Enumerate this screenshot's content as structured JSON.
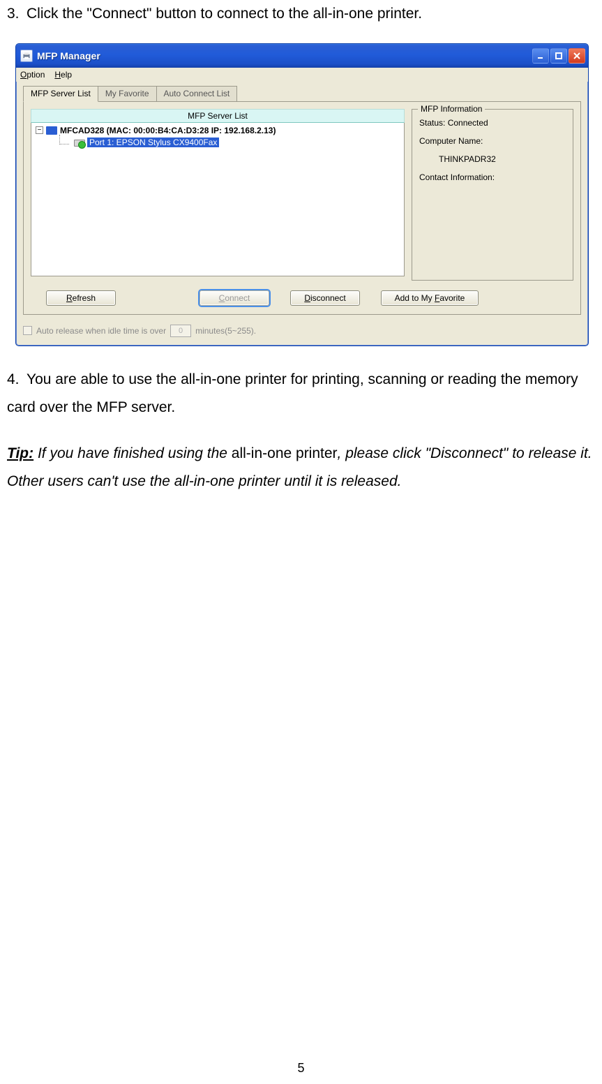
{
  "steps": {
    "s3_num": "3.",
    "s3_text": "Click the \"Connect\" button to connect to the all-in-one printer.",
    "s4_num": "4.",
    "s4_text": "You are able to use the all-in-one printer for printing, scanning or reading the memory card over the MFP server."
  },
  "tip": {
    "label": "Tip:",
    "part1": " If you have finished using the ",
    "nonitalic": "all-in-one printer",
    "part2": ", please click \"Disconnect\" to release it. Other users can't use the all-in-one printer until it is released."
  },
  "page_number": "5",
  "win": {
    "title": "MFP Manager",
    "menu": {
      "option": "Option",
      "help": "Help"
    },
    "tabs": {
      "t1": "MFP Server List",
      "t2": "My Favorite",
      "t3": "Auto Connect List"
    },
    "list": {
      "header": "MFP Server List",
      "root_expander": "−",
      "root_label": "MFCAD328 (MAC: 00:00:B4:CA:D3:28   IP: 192.168.2.13)",
      "child_label": "Port 1: EPSON Stylus CX9400Fax"
    },
    "info": {
      "legend": "MFP Information",
      "status_label": "Status: ",
      "status_value": "Connected",
      "cname_label": "Computer Name:",
      "cname_value": "THINKPADR32",
      "contact_label": "Contact Information:"
    },
    "buttons": {
      "refresh": "Refresh",
      "connect": "Connect",
      "disconnect": "Disconnect",
      "addfav": "Add to My Favorite"
    },
    "auto": {
      "label_pre": "Auto release when idle time is over",
      "value": "0",
      "label_post": "minutes(5~255)."
    }
  }
}
